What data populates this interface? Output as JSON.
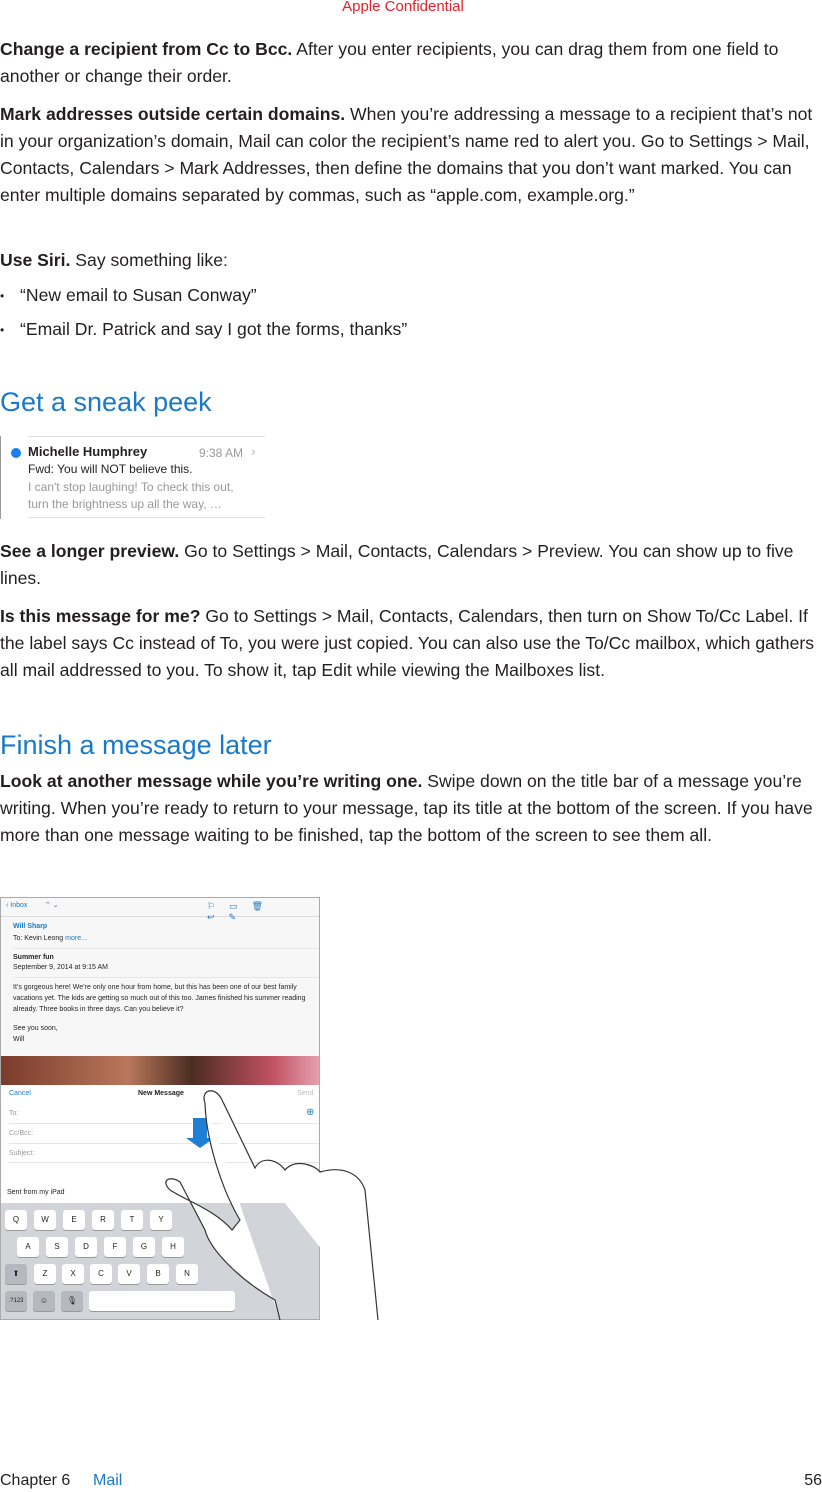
{
  "header": {
    "confidential": "Apple Confidential"
  },
  "sections": {
    "cc_bcc": {
      "lead": "Change a recipient from Cc to Bcc.",
      "text": " After you enter recipients, you can drag them from one ﬁeld to another or change their order."
    },
    "mark": {
      "lead": "Mark addresses outside certain domains.",
      "text": " When you’re addressing a message to a recipient that’s not in your organization’s domain, Mail can color the recipient’s name red to alert you. Go to Settings > Mail, Contacts, Calendars > Mark Addresses, then deﬁne the domains that you don’t want marked. You can enter multiple domains separated by commas, such as “apple.com, example.org.”"
    },
    "siri": {
      "lead": "Use Siri.",
      "text": " Say something like:",
      "bullets": [
        "“New email to Susan Conway”",
        "“Email Dr. Patrick and say I got the forms, thanks”"
      ]
    },
    "peek_heading": "Get a sneak peek",
    "preview_image": {
      "sender": "Michelle Humphrey",
      "time": "9:38 AM",
      "subject": "Fwd: You will NOT believe this.",
      "body": "I can't stop laughing! To check this out, turn the brightness up all the way, …",
      "unread_color": "#1a7ff0"
    },
    "longer": {
      "lead": "See a longer preview.",
      "text": " Go to Settings > Mail, Contacts, Calendars > Preview. You can show up to ﬁve lines."
    },
    "forme": {
      "lead": "Is this message for me?",
      "text": " Go to Settings > Mail, Contacts, Calendars, then turn on Show To/Cc Label. If the label says Cc instead of To, you were just copied. You can also use the To/Cc mailbox, which gathers all mail addressed to you. To show it, tap Edit while viewing the Mailboxes list."
    },
    "finish_heading": "Finish a message later",
    "look": {
      "lead": "Look at another message while you’re writing one.",
      "text": " Swipe down on the title bar of a message you’re writing. When you’re ready to return to your message, tap its title at the bottom of the screen. If you have more than one message waiting to be ﬁnished, tap the bottom of the screen to see them all."
    }
  },
  "ipad": {
    "back": "Inbox",
    "from": "Will Sharp",
    "to_label": "To: Kevin Leong",
    "more": "more...",
    "subject": "Summer fun",
    "date": "September 9, 2014 at 9:15 AM",
    "body": "It’s gorgeous here! We’re only one hour from home, but this has been one of our best family vacations yet. The kids are getting so much out of this too. James finished his summer reading already. Three books in three days. Can you believe it?",
    "signoff": "See you soon,",
    "sign": "Will",
    "compose": {
      "cancel": "Cancel",
      "title": "New Message",
      "send": "Send",
      "to": "To:",
      "ccbcc": "Cc/Bcc:",
      "subject": "Subject:",
      "signature": "Sent from my iPad"
    },
    "keys_row1": [
      "Q",
      "W",
      "E",
      "R",
      "T",
      "Y"
    ],
    "keys_row2": [
      "A",
      "S",
      "D",
      "F",
      "G",
      "H"
    ],
    "keys_row3": [
      "Z",
      "X",
      "C",
      "V",
      "B",
      "N"
    ],
    "key_num": ".?123"
  },
  "footer": {
    "chapter": "Chapter  6",
    "title": "Mail",
    "page": "56"
  }
}
